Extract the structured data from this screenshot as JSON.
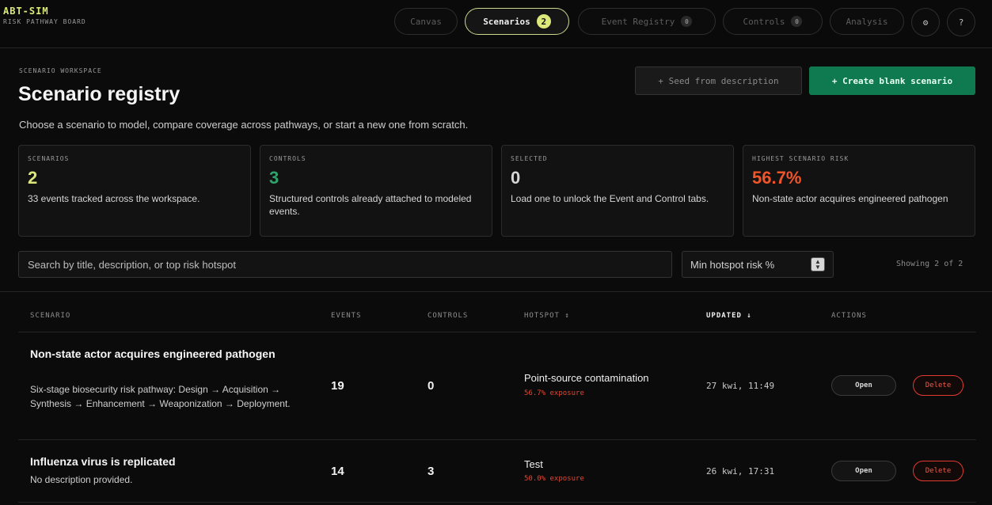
{
  "brand": {
    "name": "ABT-SIM",
    "subtitle": "RISK PATHWAY BOARD"
  },
  "nav": {
    "tabs": [
      {
        "label": "Canvas",
        "badge": ""
      },
      {
        "label": "Scenarios",
        "badge": "2",
        "active": true
      },
      {
        "label": "Event Registry",
        "badge": "0"
      },
      {
        "label": "Controls",
        "badge": "0"
      },
      {
        "label": "Analysis",
        "badge": ""
      }
    ],
    "settings_glyph": "⚙",
    "help_glyph": "?"
  },
  "header": {
    "eyebrow": "SCENARIO WORKSPACE",
    "title": "Scenario registry",
    "subtitle": "Choose a scenario to model, compare coverage across pathways, or start a new one from scratch.",
    "seed_label": "+ Seed from description",
    "create_label": "+ Create blank scenario"
  },
  "stats": [
    {
      "label": "SCENARIOS",
      "value": "2",
      "desc": "33 events tracked across the workspace.",
      "color": "#dce87a"
    },
    {
      "label": "CONTROLS",
      "value": "3",
      "desc": "Structured controls already attached to modeled events.",
      "color": "#2fa36b"
    },
    {
      "label": "SELECTED",
      "value": "0",
      "desc": "Load one to unlock the Event and Control tabs.",
      "color": "#d6d6d6"
    },
    {
      "label": "HIGHEST SCENARIO RISK",
      "value": "56.7%",
      "desc": "Non-state actor acquires engineered pathogen",
      "color": "#f0552a"
    }
  ],
  "filters": {
    "search_placeholder": "Search by title, description, or top risk hotspot",
    "min_risk_placeholder": "Min hotspot risk %",
    "showing": "Showing 2 of 2"
  },
  "table": {
    "headers": {
      "scenario": "SCENARIO",
      "events": "EVENTS",
      "controls": "CONTROLS",
      "hotspot": "HOTSPOT ↕",
      "updated": "UPDATED ↓",
      "actions": "ACTIONS"
    },
    "rows": [
      {
        "title": "Non-state actor acquires engineered pathogen",
        "description": "Six-stage biosecurity risk pathway: Design → Acquisition → Synthesis → Enhancement → Weaponization → Deployment.",
        "events": "19",
        "controls": "0",
        "hotspot": "Point-source contamination",
        "exposure": "56.7% exposure",
        "updated": "27 kwi, 11:49",
        "open_label": "Open",
        "delete_label": "Delete"
      },
      {
        "title": "Influenza virus is replicated",
        "description": "No description provided.",
        "events": "14",
        "controls": "3",
        "hotspot": "Test",
        "exposure": "50.0% exposure",
        "updated": "26 kwi, 17:31",
        "open_label": "Open",
        "delete_label": "Delete"
      }
    ]
  }
}
